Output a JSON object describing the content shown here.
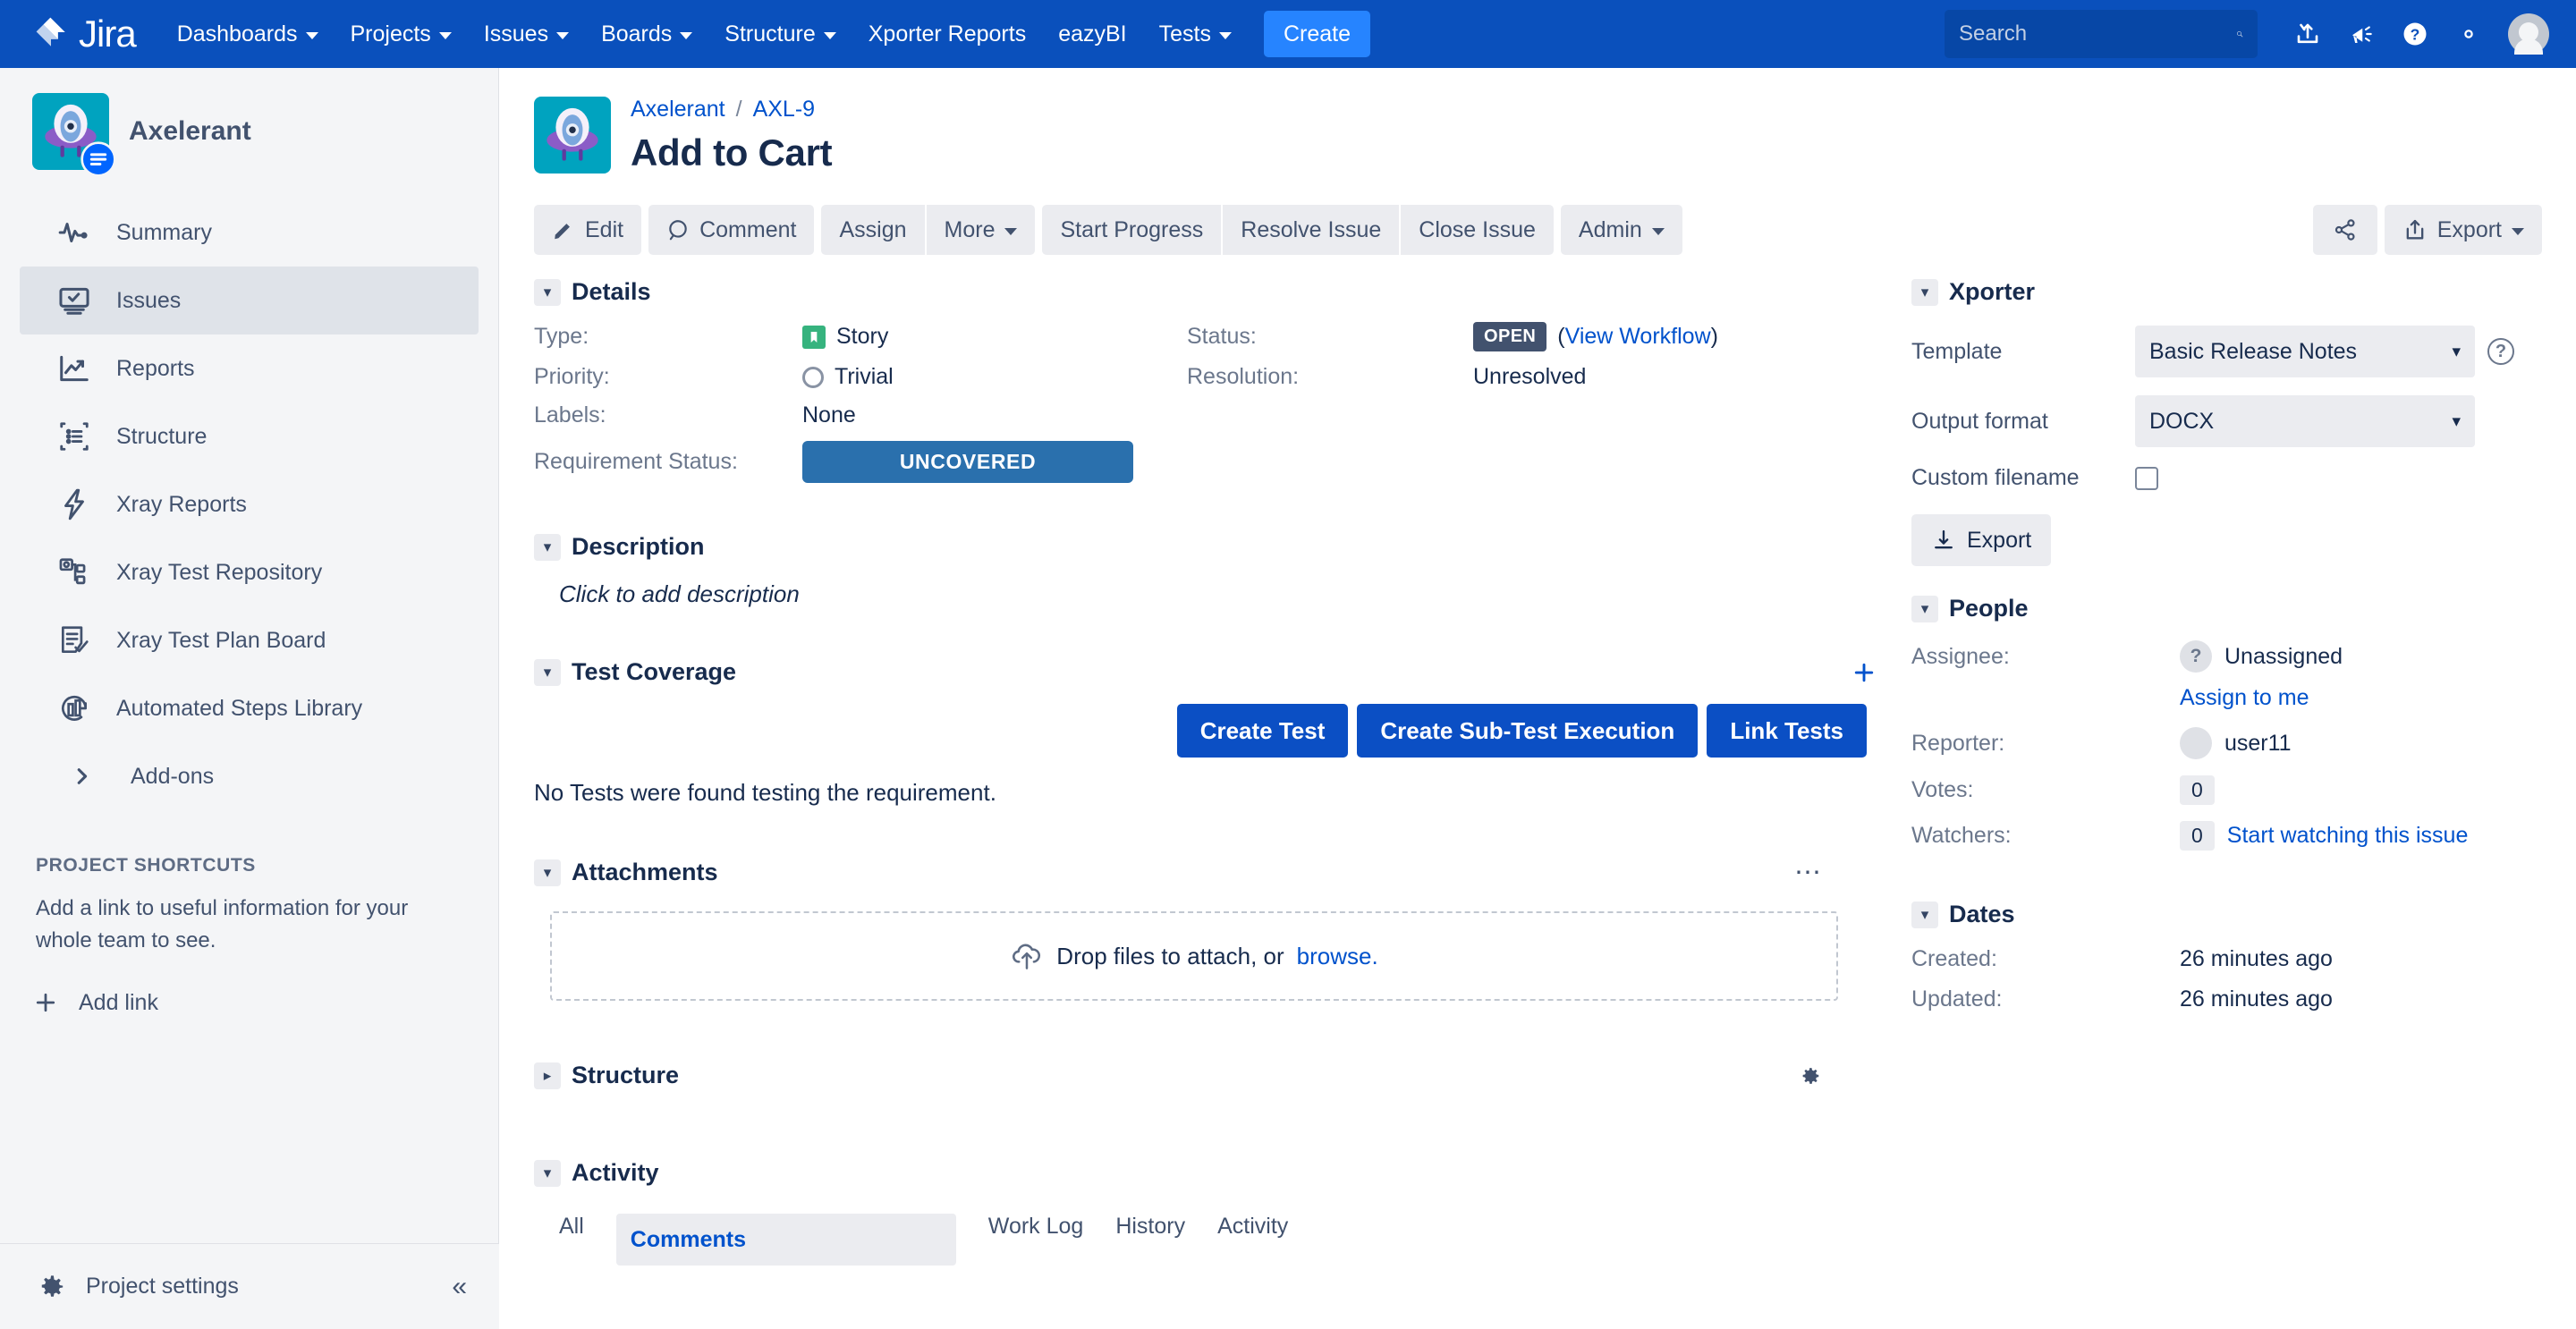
{
  "topnav": {
    "logo_text": "Jira",
    "items": [
      {
        "label": "Dashboards",
        "has_caret": true
      },
      {
        "label": "Projects",
        "has_caret": true
      },
      {
        "label": "Issues",
        "has_caret": true
      },
      {
        "label": "Boards",
        "has_caret": true
      },
      {
        "label": "Structure",
        "has_caret": true
      },
      {
        "label": "Xporter Reports",
        "has_caret": false
      },
      {
        "label": "eazyBI",
        "has_caret": false
      },
      {
        "label": "Tests",
        "has_caret": true
      }
    ],
    "create_label": "Create",
    "search_placeholder": "Search",
    "icons": [
      "import-icon",
      "megaphone-icon",
      "help-icon",
      "settings-icon",
      "profile-avatar"
    ]
  },
  "sidebar": {
    "project_name": "Axelerant",
    "items": [
      {
        "label": "Summary",
        "icon": "pulse-icon",
        "active": false
      },
      {
        "label": "Issues",
        "icon": "issues-monitor-icon",
        "active": true
      },
      {
        "label": "Reports",
        "icon": "chart-trend-icon",
        "active": false
      },
      {
        "label": "Structure",
        "icon": "structure-list-icon",
        "active": false
      },
      {
        "label": "Xray Reports",
        "icon": "lightning-icon",
        "active": false
      },
      {
        "label": "Xray Test Repository",
        "icon": "repository-tree-icon",
        "active": false
      },
      {
        "label": "Xray Test Plan Board",
        "icon": "test-plan-icon",
        "active": false
      },
      {
        "label": "Automated Steps Library",
        "icon": "automation-icon",
        "active": false
      },
      {
        "label": "Add-ons",
        "icon": "chevron-right-icon",
        "active": false
      }
    ],
    "shortcuts_title": "PROJECT SHORTCUTS",
    "shortcuts_desc": "Add a link to useful information for your whole team to see.",
    "add_link_label": "Add link",
    "project_settings_label": "Project settings",
    "collapse_icon": "double-chevron-left-icon"
  },
  "issue": {
    "breadcrumb_project": "Axelerant",
    "breadcrumb_sep": "/",
    "breadcrumb_key": "AXL-9",
    "title": "Add to Cart"
  },
  "toolbar": {
    "edit_label": "Edit",
    "comment_label": "Comment",
    "assign_label": "Assign",
    "more_label": "More",
    "start_progress_label": "Start Progress",
    "resolve_issue_label": "Resolve Issue",
    "close_issue_label": "Close Issue",
    "admin_label": "Admin",
    "share_icon": "share-icon",
    "export_label": "Export"
  },
  "details": {
    "section_title": "Details",
    "type_label": "Type:",
    "type_value": "Story",
    "priority_label": "Priority:",
    "priority_value": "Trivial",
    "labels_label": "Labels:",
    "labels_value": "None",
    "req_status_label": "Requirement Status:",
    "req_status_value": "UNCOVERED",
    "status_label": "Status:",
    "status_value": "OPEN",
    "status_workflow_open": "(",
    "status_workflow_link": "View Workflow",
    "status_workflow_close": ")",
    "resolution_label": "Resolution:",
    "resolution_value": "Unresolved"
  },
  "description": {
    "section_title": "Description",
    "placeholder": "Click to add description"
  },
  "test_coverage": {
    "section_title": "Test Coverage",
    "add_icon": "plus-icon",
    "create_test_label": "Create Test",
    "create_sub_test_label": "Create Sub-Test Execution",
    "link_tests_label": "Link Tests",
    "empty_message": "No Tests were found testing the requirement."
  },
  "attachments": {
    "section_title": "Attachments",
    "more_icon": "ellipsis-icon",
    "drop_text": "Drop files to attach, or",
    "browse_link": "browse."
  },
  "structure": {
    "section_title": "Structure",
    "gear_icon": "gear-icon"
  },
  "activity": {
    "section_title": "Activity",
    "tabs": [
      {
        "label": "All",
        "selected": false
      },
      {
        "label": "Comments",
        "selected": true
      },
      {
        "label": "Work Log",
        "selected": false
      },
      {
        "label": "History",
        "selected": false
      },
      {
        "label": "Activity",
        "selected": false
      }
    ]
  },
  "xporter": {
    "section_title": "Xporter",
    "template_label": "Template",
    "template_value": "Basic Release Notes",
    "output_format_label": "Output format",
    "output_format_value": "DOCX",
    "custom_filename_label": "Custom filename",
    "export_label": "Export",
    "help_icon": "question-circle-icon"
  },
  "people": {
    "section_title": "People",
    "assignee_label": "Assignee:",
    "assignee_value": "Unassigned",
    "assign_to_me": "Assign to me",
    "reporter_label": "Reporter:",
    "reporter_value": "user11",
    "votes_label": "Votes:",
    "votes_value": "0",
    "watchers_label": "Watchers:",
    "watchers_value": "0",
    "watch_link": "Start watching this issue"
  },
  "dates": {
    "section_title": "Dates",
    "created_label": "Created:",
    "created_value": "26 minutes ago",
    "updated_label": "Updated:",
    "updated_value": "26 minutes ago"
  },
  "colors": {
    "nav_blue": "#0a50bc",
    "create_blue": "#2684ff",
    "link_blue": "#0052cc",
    "primary_btn": "#0b4fc4",
    "req_status_blue": "#2a70ad",
    "story_green": "#36b37e",
    "sidebar_bg": "#f4f5f7",
    "project_teal": "#00a3bf"
  }
}
